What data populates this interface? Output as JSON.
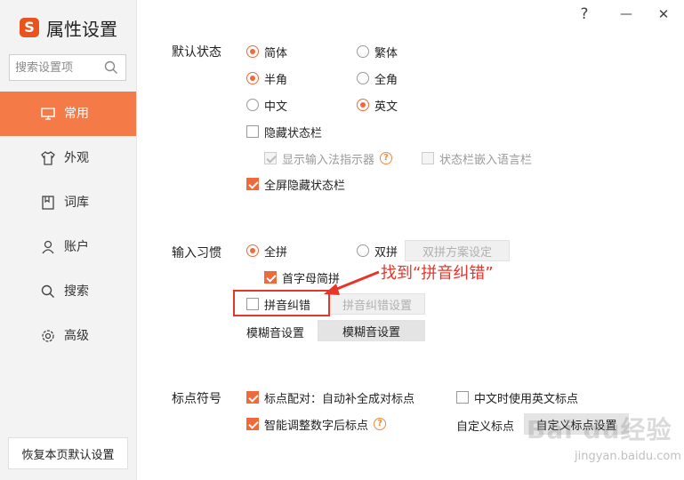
{
  "app": {
    "logo_glyph": "S",
    "title": "属性设置"
  },
  "titlebar": {
    "help": "?",
    "minimize": "—",
    "close": "✕"
  },
  "search": {
    "placeholder": "搜索设置项"
  },
  "nav": [
    {
      "label": "常用",
      "icon": "monitor-icon",
      "active": true
    },
    {
      "label": "外观",
      "icon": "shirt-icon"
    },
    {
      "label": "词库",
      "icon": "book-icon"
    },
    {
      "label": "账户",
      "icon": "user-icon"
    },
    {
      "label": "搜索",
      "icon": "search-icon"
    },
    {
      "label": "高级",
      "icon": "gear-icon"
    }
  ],
  "restore_button": "恢复本页默认设置",
  "default_state": {
    "label": "默认状态",
    "simplified": "简体",
    "traditional": "繁体",
    "halfwidth": "半角",
    "fullwidth": "全角",
    "chinese": "中文",
    "english": "英文",
    "hide_statusbar": "隐藏状态栏",
    "show_indicator": "显示输入法指示器",
    "statusbar_embed": "状态栏嵌入语言栏",
    "fullscreen_hide": "全屏隐藏状态栏"
  },
  "input_habit": {
    "label": "输入习惯",
    "quanpin": "全拼",
    "shuangpin": "双拼",
    "shuangpin_settings": "双拼方案设定",
    "initial_abbrev": "首字母简拼",
    "pinyin_correction": "拼音纠错",
    "pinyin_correction_settings": "拼音纠错设置",
    "fuzzy_label": "模糊音设置",
    "fuzzy_button": "模糊音设置"
  },
  "punctuation": {
    "label": "标点符号",
    "auto_pair": "标点配对：自动补全成对标点",
    "use_english_in_chinese": "中文时使用英文标点",
    "smart_after_digits": "智能调整数字后标点",
    "custom_label": "自定义标点",
    "custom_button": "自定义标点设置"
  },
  "annotation": {
    "text": "找到“拼音纠错”"
  },
  "watermark": {
    "text": "Bai du经验",
    "url": "jingyan.baidu.com"
  },
  "colors": {
    "accent": "#f47b48",
    "check": "#f0693a",
    "annotation": "#e8352b"
  }
}
